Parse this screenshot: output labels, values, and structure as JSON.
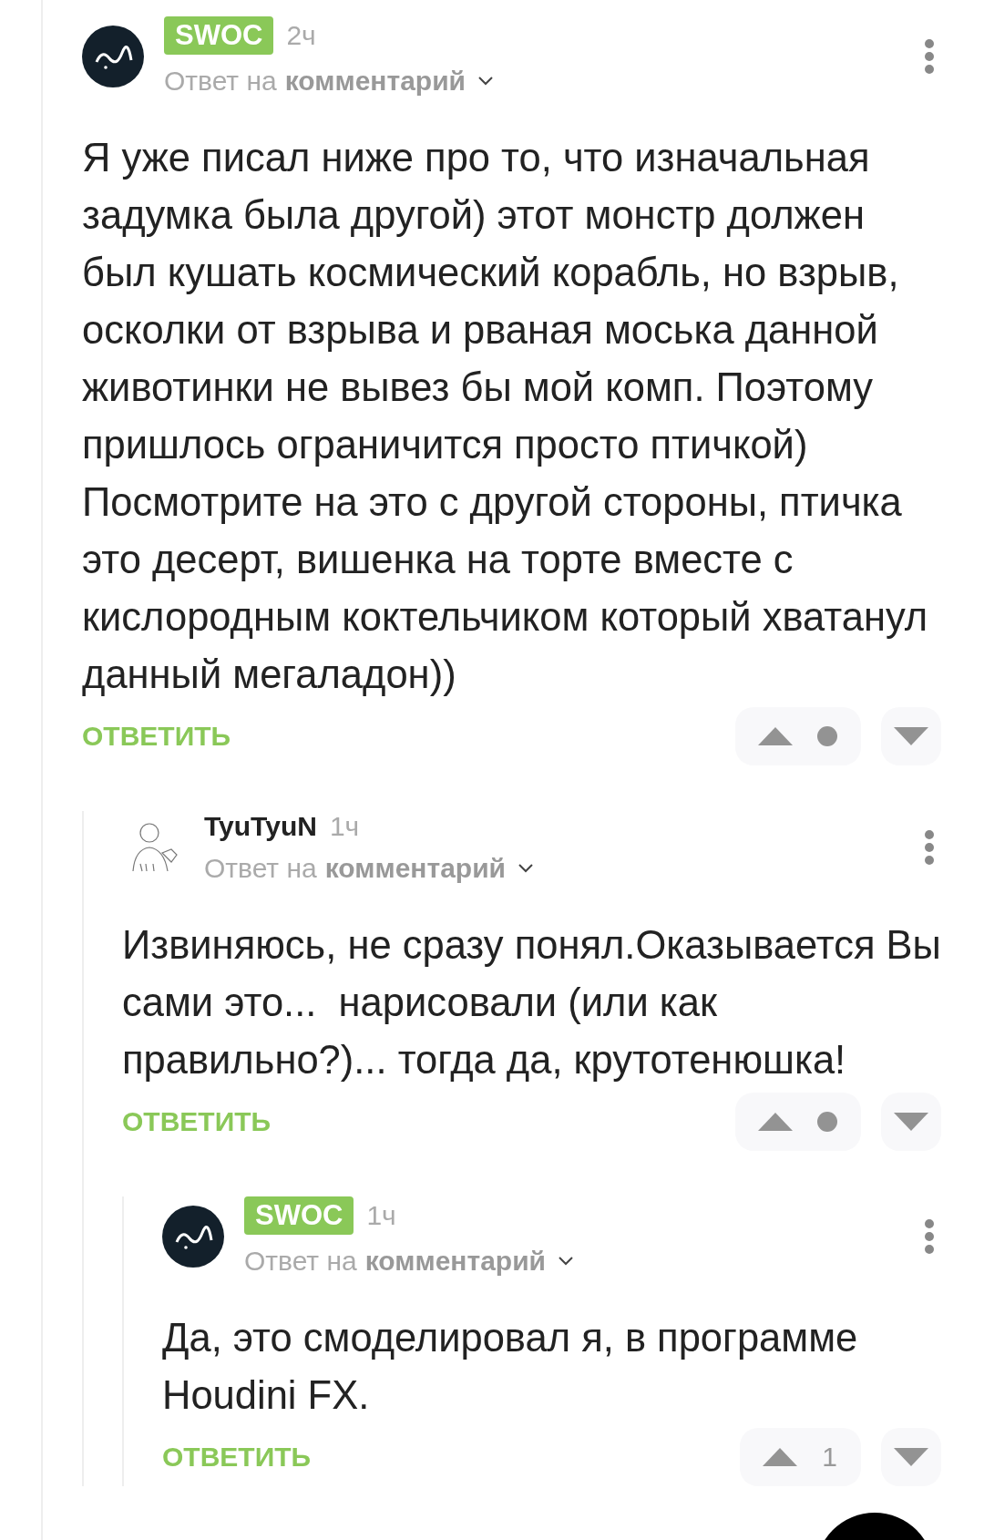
{
  "comments": [
    {
      "author": "SWOC",
      "author_badge": true,
      "avatar": {
        "kind": "dark"
      },
      "time": "2ч",
      "reply_prefix": "Ответ на",
      "reply_target": "комментарий",
      "text": "Я уже писал ниже про то, что изначальная задумка была другой) этот монстр должен был кушать космический корабль, но взрыв, осколки от взрыва и рваная моська данной животинки не вывез бы мой комп. Поэтому пришлось ограничится просто птичкой) Посмотрите на это с другой стороны, птичка это десерт, вишенка на торте вместе с кислородным коктельчиком который хватанул данный мегаладон))",
      "reply_label": "ОТВЕТИТЬ",
      "children": [
        {
          "author": "TyuTyuN",
          "author_badge": false,
          "avatar": {
            "kind": "sketch"
          },
          "time": "1ч",
          "reply_prefix": "Ответ на",
          "reply_target": "комментарий",
          "text": "Извиняюсь, не сразу понял.Оказывается Вы сами это...  нарисовали (или как правильно?)... тогда да, крутотенюшка!",
          "reply_label": "ОТВЕТИТЬ",
          "children": [
            {
              "author": "SWOC",
              "author_badge": true,
              "avatar": {
                "kind": "dark"
              },
              "time": "1ч",
              "reply_prefix": "Ответ на",
              "reply_target": "комментарий",
              "text": "Да, это смоделировал я, в программе Houdini FX.",
              "reply_label": "ОТВЕТИТЬ",
              "score": "1"
            }
          ]
        }
      ]
    }
  ]
}
